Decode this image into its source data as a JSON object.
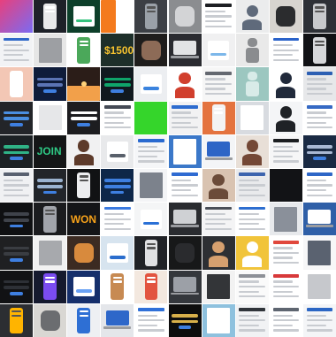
{
  "grid": {
    "rows": 10,
    "cols": 10,
    "background": "#ffffff",
    "tiles": [
      {
        "bg": "#e7407d",
        "accent": "#7b6bf2",
        "kind": "gradient"
      },
      {
        "bg": "#1e2128",
        "accent": "#e9e9ea",
        "kind": "phone"
      },
      {
        "bg": "#0d3f2a",
        "accent": "#34c37d",
        "kind": "dialog"
      },
      {
        "bg": "#ffffff",
        "accent": "#f47a1d",
        "kind": "split"
      },
      {
        "bg": "#3c3f45",
        "accent": "#9aa0a8",
        "kind": "phone-dark"
      },
      {
        "bg": "#8b8d90",
        "accent": "#d3d4d6",
        "kind": "photo"
      },
      {
        "bg": "#ffffff",
        "accent": "#1d1f23",
        "kind": "list"
      },
      {
        "bg": "#ebeced",
        "accent": "#5f6a7b",
        "kind": "avatars"
      },
      {
        "bg": "#d7d4cf",
        "accent": "#2b2c2e",
        "kind": "photo"
      },
      {
        "bg": "#2d3036",
        "accent": "#c7c9cc",
        "kind": "phone-dark"
      },
      {
        "bg": "#f2f3f5",
        "accent": "#2f68c8",
        "kind": "form"
      },
      {
        "bg": "#e6e6e6",
        "accent": "#9d9fa3",
        "kind": "paper"
      },
      {
        "bg": "#ffffff",
        "accent": "#4ba85a",
        "kind": "phone"
      },
      {
        "bg": "#1e2f2a",
        "accent": "#f6c22f",
        "kind": "banner",
        "caption": "$1500"
      },
      {
        "bg": "#1f1d1c",
        "accent": "#8d6b57",
        "kind": "photo"
      },
      {
        "bg": "#2a2b30",
        "accent": "#e2e3e5",
        "kind": "laptop"
      },
      {
        "bg": "#f0f0f1",
        "accent": "#7cb7ea",
        "kind": "card"
      },
      {
        "bg": "#e9e9e9",
        "accent": "#8a8c8f",
        "kind": "robot"
      },
      {
        "bg": "#ffffff",
        "accent": "#2b63c9",
        "kind": "form"
      },
      {
        "bg": "#111215",
        "accent": "#d6d7da",
        "kind": "phone-dark"
      },
      {
        "bg": "#f3c7b5",
        "accent": "#ffffff",
        "kind": "phone"
      },
      {
        "bg": "#0f1c3a",
        "accent": "#5b74b4",
        "kind": "dark-ui"
      },
      {
        "bg": "#2b1d18",
        "accent": "#f18e2c",
        "kind": "sunset"
      },
      {
        "bg": "#11191f",
        "accent": "#0fa46a",
        "kind": "dark-ui"
      },
      {
        "bg": "#eceef1",
        "accent": "#3b83de",
        "kind": "card"
      },
      {
        "bg": "#ffffff",
        "accent": "#d13f2d",
        "kind": "avatars"
      },
      {
        "bg": "#f6f6f6",
        "accent": "#646870",
        "kind": "list"
      },
      {
        "bg": "#9cc7c0",
        "accent": "#d8ebe8",
        "kind": "robot"
      },
      {
        "bg": "#ffffff",
        "accent": "#212a3b",
        "kind": "avatars"
      },
      {
        "bg": "#e7e8ea",
        "accent": "#2c5fb3",
        "kind": "form"
      },
      {
        "bg": "#232529",
        "accent": "#4a8fe2",
        "kind": "dark-ui"
      },
      {
        "bg": "#ffffff",
        "accent": "#e6e7e9",
        "kind": "paper"
      },
      {
        "bg": "#1d1d20",
        "accent": "#ffffff",
        "kind": "dark-ui"
      },
      {
        "bg": "#ffffff",
        "accent": "#444a55",
        "kind": "list"
      },
      {
        "bg": "#35d52b",
        "accent": "#35d52b",
        "kind": "solid"
      },
      {
        "bg": "#f2f2f3",
        "accent": "#2d6ccf",
        "kind": "list"
      },
      {
        "bg": "#e4733f",
        "accent": "#f3f3f3",
        "kind": "phone"
      },
      {
        "bg": "#d8dbe0",
        "accent": "#ffffff",
        "kind": "paper"
      },
      {
        "bg": "#f4f5f7",
        "accent": "#1f2226",
        "kind": "avatars"
      },
      {
        "bg": "#ffffff",
        "accent": "#3569c4",
        "kind": "list"
      },
      {
        "bg": "#1c2124",
        "accent": "#2fb386",
        "kind": "dark-ui"
      },
      {
        "bg": "#141617",
        "accent": "#2ecb86",
        "kind": "banner",
        "caption": "JOIN"
      },
      {
        "bg": "#f1f1f2",
        "accent": "#5d3a2a",
        "kind": "avatars"
      },
      {
        "bg": "#e8e9eb",
        "accent": "#59606b",
        "kind": "card"
      },
      {
        "bg": "#f5f6f8",
        "accent": "#2a6ad0",
        "kind": "form"
      },
      {
        "bg": "#3b78c9",
        "accent": "#ffffff",
        "kind": "paper"
      },
      {
        "bg": "#f4f5f7",
        "accent": "#2d65c6",
        "kind": "laptop"
      },
      {
        "bg": "#e8dfd7",
        "accent": "#744836",
        "kind": "portrait"
      },
      {
        "bg": "#f6f6f7",
        "accent": "#1d1f22",
        "kind": "list"
      },
      {
        "bg": "#1a2a43",
        "accent": "#a9b8d3",
        "kind": "dark-ui"
      },
      {
        "bg": "#f0f1f3",
        "accent": "#596170",
        "kind": "form"
      },
      {
        "bg": "#22252a",
        "accent": "#9bb3d0",
        "kind": "dark-ui"
      },
      {
        "bg": "#111214",
        "accent": "#edeef0",
        "kind": "phone-dark"
      },
      {
        "bg": "#0e2749",
        "accent": "#3e7fe0",
        "kind": "dark-ui"
      },
      {
        "bg": "#f3f4f6",
        "accent": "#7c828c",
        "kind": "paper"
      },
      {
        "bg": "#ffffff",
        "accent": "#2f6bd2",
        "kind": "list"
      },
      {
        "bg": "#d9c3b1",
        "accent": "#6b4b39",
        "kind": "portrait"
      },
      {
        "bg": "#e9eaec",
        "accent": "#3c64ae",
        "kind": "list"
      },
      {
        "bg": "#121316",
        "accent": "#1f2024",
        "kind": "solid"
      },
      {
        "bg": "#ffffff",
        "accent": "#2d66c7",
        "kind": "form"
      },
      {
        "bg": "#0f1012",
        "accent": "#3f434b",
        "kind": "dark-ui"
      },
      {
        "bg": "#1b1c1f",
        "accent": "#a1a4ab",
        "kind": "phone-dark"
      },
      {
        "bg": "#141518",
        "accent": "#f7a21a",
        "kind": "banner",
        "caption": "WON"
      },
      {
        "bg": "#ffffff",
        "accent": "#3a7ae0",
        "kind": "form"
      },
      {
        "bg": "#f4f5f6",
        "accent": "#2a70d6",
        "kind": "card"
      },
      {
        "bg": "#2a2c30",
        "accent": "#cfd1d4",
        "kind": "laptop"
      },
      {
        "bg": "#f4f4f5",
        "accent": "#4a4f58",
        "kind": "list"
      },
      {
        "bg": "#ffffff",
        "accent": "#2d6ed0",
        "kind": "form"
      },
      {
        "bg": "#e7e9ec",
        "accent": "#8a909a",
        "kind": "paper"
      },
      {
        "bg": "#2f5fa7",
        "accent": "#ffffff",
        "kind": "laptop"
      },
      {
        "bg": "#1f2022",
        "accent": "#3a3d42",
        "kind": "dark-ui"
      },
      {
        "bg": "#f1f1f1",
        "accent": "#a7a9ad",
        "kind": "paper"
      },
      {
        "bg": "#3c2b22",
        "accent": "#d88a3d",
        "kind": "photo"
      },
      {
        "bg": "#d7e4ef",
        "accent": "#2a6dcd",
        "kind": "card"
      },
      {
        "bg": "#202226",
        "accent": "#e0e1e3",
        "kind": "phone-dark"
      },
      {
        "bg": "#171819",
        "accent": "#2a2b2e",
        "kind": "photo"
      },
      {
        "bg": "#2d2f33",
        "accent": "#d6a06f",
        "kind": "portrait"
      },
      {
        "bg": "#f1c43a",
        "accent": "#ffffff",
        "kind": "avatars"
      },
      {
        "bg": "#ffffff",
        "accent": "#e0483d",
        "kind": "list"
      },
      {
        "bg": "#f7f7f8",
        "accent": "#5a6270",
        "kind": "paper"
      },
      {
        "bg": "#111214",
        "accent": "#2d3036",
        "kind": "dark-ui"
      },
      {
        "bg": "#151a2e",
        "accent": "#7a4cf0",
        "kind": "phone"
      },
      {
        "bg": "#152f6b",
        "accent": "#6aa2f4",
        "kind": "dialog"
      },
      {
        "bg": "#ffffff",
        "accent": "#c78a52",
        "kind": "phone"
      },
      {
        "bg": "#f3e8df",
        "accent": "#e25440",
        "kind": "phone"
      },
      {
        "bg": "#34373c",
        "accent": "#9ca0a7",
        "kind": "laptop"
      },
      {
        "bg": "#f2f2f2",
        "accent": "#333538",
        "kind": "paper"
      },
      {
        "bg": "#fafafa",
        "accent": "#8d9097",
        "kind": "list"
      },
      {
        "bg": "#ffffff",
        "accent": "#d8393a",
        "kind": "form"
      },
      {
        "bg": "#ffffff",
        "accent": "#c6c8cc",
        "kind": "paper"
      },
      {
        "bg": "#2c2e32",
        "accent": "#ffb400",
        "kind": "phone-dark"
      },
      {
        "bg": "#d9d7d3",
        "accent": "#6b6d70",
        "kind": "photo"
      },
      {
        "bg": "#eef0f3",
        "accent": "#2e6fd4",
        "kind": "phone"
      },
      {
        "bg": "#e4e6ea",
        "accent": "#2e67c9",
        "kind": "laptop"
      },
      {
        "bg": "#ffffff",
        "accent": "#2f70d8",
        "kind": "list"
      },
      {
        "bg": "#0d0d0d",
        "accent": "#d8b04a",
        "kind": "dark-ui"
      },
      {
        "bg": "#8ec1de",
        "accent": "#ffffff",
        "kind": "paper"
      },
      {
        "bg": "#f1f2f4",
        "accent": "#30343a",
        "kind": "form"
      },
      {
        "bg": "#ffffff",
        "accent": "#5e6570",
        "kind": "list"
      },
      {
        "bg": "#f4f5f7",
        "accent": "#2b66c4",
        "kind": "form"
      }
    ]
  }
}
